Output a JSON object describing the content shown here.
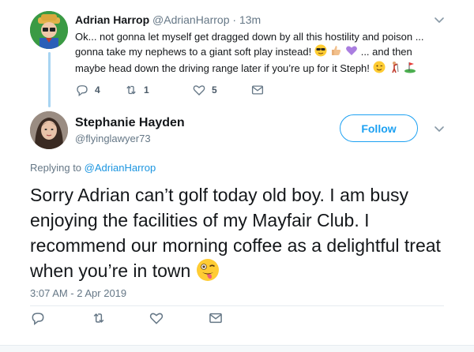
{
  "parent_tweet": {
    "name": "Adrian Harrop",
    "handle": "@AdrianHarrop",
    "separator": "·",
    "time": "13m",
    "text_line1": "Ok... not gonna let myself get dragged down by all this hostility and poison ...",
    "text_line2_a": "gonna take my nephews to a giant soft play instead!",
    "text_line2_b": "... and then",
    "text_line3": "maybe head down the driving range later if you’re up for it Steph!",
    "reply_count": "4",
    "retweet_count": "1",
    "like_count": "5"
  },
  "reply_tweet": {
    "name": "Stephanie Hayden",
    "handle": "@flyinglawyer73",
    "follow_label": "Follow",
    "replying_prefix": "Replying to",
    "replying_handle": "@AdrianHarrop",
    "text": "Sorry Adrian can’t golf today old boy. I am busy enjoying the facilities of my Mayfair Club. I recommend our morning coffee as a delightful treat when you’re in town",
    "timestamp": "3:07 AM - 2 Apr 2019"
  },
  "colors": {
    "accent": "#1da1f2",
    "secondary_text": "#657786",
    "thread_line": "#a8d4f2"
  },
  "icons": [
    "reply-icon",
    "retweet-icon",
    "like-icon",
    "message-icon",
    "chevron-down-icon"
  ]
}
